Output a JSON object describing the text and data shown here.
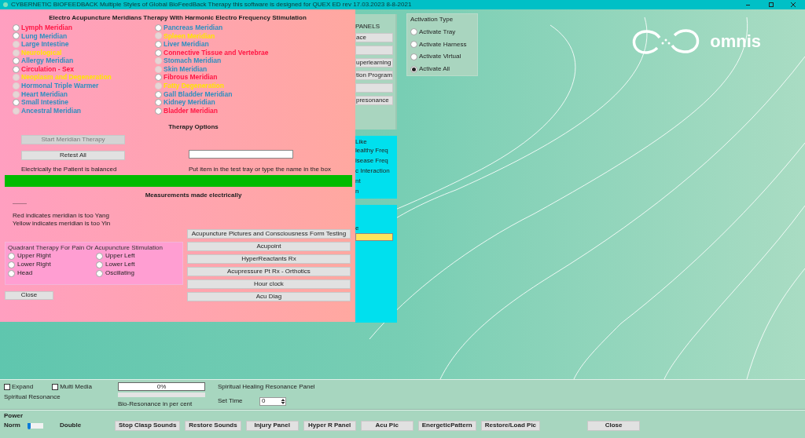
{
  "window": {
    "title": "CYBERNETIC BIOFEEDBACK  Multiple Styles of Global BioFeedBack Therapy  this software is designed for QUEX ED rev 17.03.2023 8-8-2021"
  },
  "dialog": {
    "title": "Electro Acupuncture Meridians Therapy With Harmonic Electro Frequency Stimulation",
    "meridian_columns": [
      {
        "items": [
          {
            "label": "Lymph Meridian",
            "color": "#ff1744",
            "disabled": false
          },
          {
            "label": "Lung Meridian",
            "color": "#2e8fc0",
            "disabled": false
          },
          {
            "label": "Large Intestine",
            "color": "#2e8fc0",
            "disabled": true
          },
          {
            "label": "Neurological",
            "color": "#ffe600",
            "disabled": true
          },
          {
            "label": "Allergy Meridian",
            "color": "#2e8fc0",
            "disabled": false
          },
          {
            "label": "Circulation - Sex",
            "color": "#ff1744",
            "disabled": false
          },
          {
            "label": "Neoplasm and Degeneration",
            "color": "#ffe600",
            "disabled": true
          },
          {
            "label": "Hormonal Triple Warmer",
            "color": "#2e8fc0",
            "disabled": true
          },
          {
            "label": "Heart Meridian",
            "color": "#2e8fc0",
            "disabled": true
          },
          {
            "label": "Small Intestine",
            "color": "#2e8fc0",
            "disabled": false
          },
          {
            "label": "Ancestral Meridian",
            "color": "#2e8fc0",
            "disabled": true
          }
        ]
      },
      {
        "items": [
          {
            "label": "Pancreas Meridian",
            "color": "#2e8fc0",
            "disabled": false
          },
          {
            "label": "Spleen Meridian",
            "color": "#ffe600",
            "disabled": true
          },
          {
            "label": "Liver Meridian",
            "color": "#2e8fc0",
            "disabled": false
          },
          {
            "label": "Connective Tissue and Vertebrae",
            "color": "#ff1744",
            "disabled": false
          },
          {
            "label": "Stomach Meridian",
            "color": "#2e8fc0",
            "disabled": true
          },
          {
            "label": "Skin Meridian",
            "color": "#2e8fc0",
            "disabled": true
          },
          {
            "label": "Fibrous Meridian",
            "color": "#ff1744",
            "disabled": false
          },
          {
            "label": "Fatty Degeneration",
            "color": "#ffe600",
            "disabled": true
          },
          {
            "label": "Gall Bladder Meridian",
            "color": "#2e8fc0",
            "disabled": false
          },
          {
            "label": "Kidney Meridian",
            "color": "#2e8fc0",
            "disabled": false
          },
          {
            "label": "Bladder Meridian",
            "color": "#ff1744",
            "disabled": false
          }
        ]
      }
    ],
    "therapy_options_heading": "Therapy Options",
    "start_button": {
      "label": "Start Meridian Therapy",
      "disabled": true
    },
    "retest_button": "Retest All",
    "status_text": "Electrically the Patient is balanced",
    "item_hint": "Put item in the test tray or type the name in the box",
    "balance_bar": {
      "level": 1
    },
    "measurements_heading": "Measurements made electrically",
    "dash_line": "---------",
    "legend": [
      "Red indicates meridian is too Yang",
      "Yellow indicates meridian is too Yin"
    ],
    "quadrant": {
      "title": "Quadrant Therapy For Pain Or Acupuncture Stimulation",
      "options": [
        {
          "label": "Upper Right",
          "selected": false
        },
        {
          "label": "Upper Left",
          "selected": false
        },
        {
          "label": "Lower Right",
          "selected": false
        },
        {
          "label": "Lower Left",
          "selected": false
        },
        {
          "label": "Head",
          "selected": false
        },
        {
          "label": "Oscillating",
          "selected": false
        }
      ]
    },
    "close_button": "Close",
    "tool_buttons": [
      "Acupuncture Pictures and Consciousness Form Testing",
      "Acupoint",
      "HyperReactants Rx",
      "Acupressure Pt Rx - Orthotics",
      "Hour clock",
      "Acu Diag"
    ]
  },
  "panels_behind": {
    "title": "PANELS",
    "buttons": [
      {
        "kind": "labeled",
        "label": "ace"
      },
      {
        "kind": "blank"
      },
      {
        "kind": "labeled",
        "label": "uperlearning"
      },
      {
        "kind": "labeled",
        "label": "tion Program"
      },
      {
        "kind": "blank"
      },
      {
        "kind": "labeled",
        "label": "presonance"
      }
    ],
    "like_panel": {
      "title": "Like",
      "items": [
        "lealthy Freq",
        "isease Freq",
        "c Interaction",
        "nt",
        "n"
      ]
    },
    "lower_panel": {
      "label": "e"
    }
  },
  "activation_type": {
    "title": "Activation Type",
    "options": [
      {
        "label": "Activate Tray",
        "selected": false
      },
      {
        "label": "Activate Harness",
        "selected": false
      },
      {
        "label": "Activate Virtual",
        "selected": false
      },
      {
        "label": "Activate All",
        "selected": true
      }
    ]
  },
  "logo": {
    "text": "omnis"
  },
  "bottom": {
    "expand": {
      "label": "Expand",
      "checked": false
    },
    "multi_media": {
      "label": "Multi Media",
      "checked": false
    },
    "spiritual_resonance": "Spiritual Resonance",
    "progress": {
      "text": "0%",
      "level": 0
    },
    "bio_bar": {
      "level": 0
    },
    "bio_label": "Bio-Resonance in per cent",
    "panel_title": "Spiritual Healing Resonance Panel",
    "set_time_label": "Set Time",
    "set_time_value": "0",
    "power_label": "Power",
    "norm_label": "Norm",
    "power_slider": {
      "level": 0
    },
    "double_label": "Double",
    "buttons": [
      "Stop Clasp Sounds",
      "Restore Sounds",
      "Injury Panel",
      "Hyper R Panel",
      "Acu Pic",
      "EnergeticPattern",
      "Restore/Load Pic"
    ],
    "close_button": "Close"
  }
}
